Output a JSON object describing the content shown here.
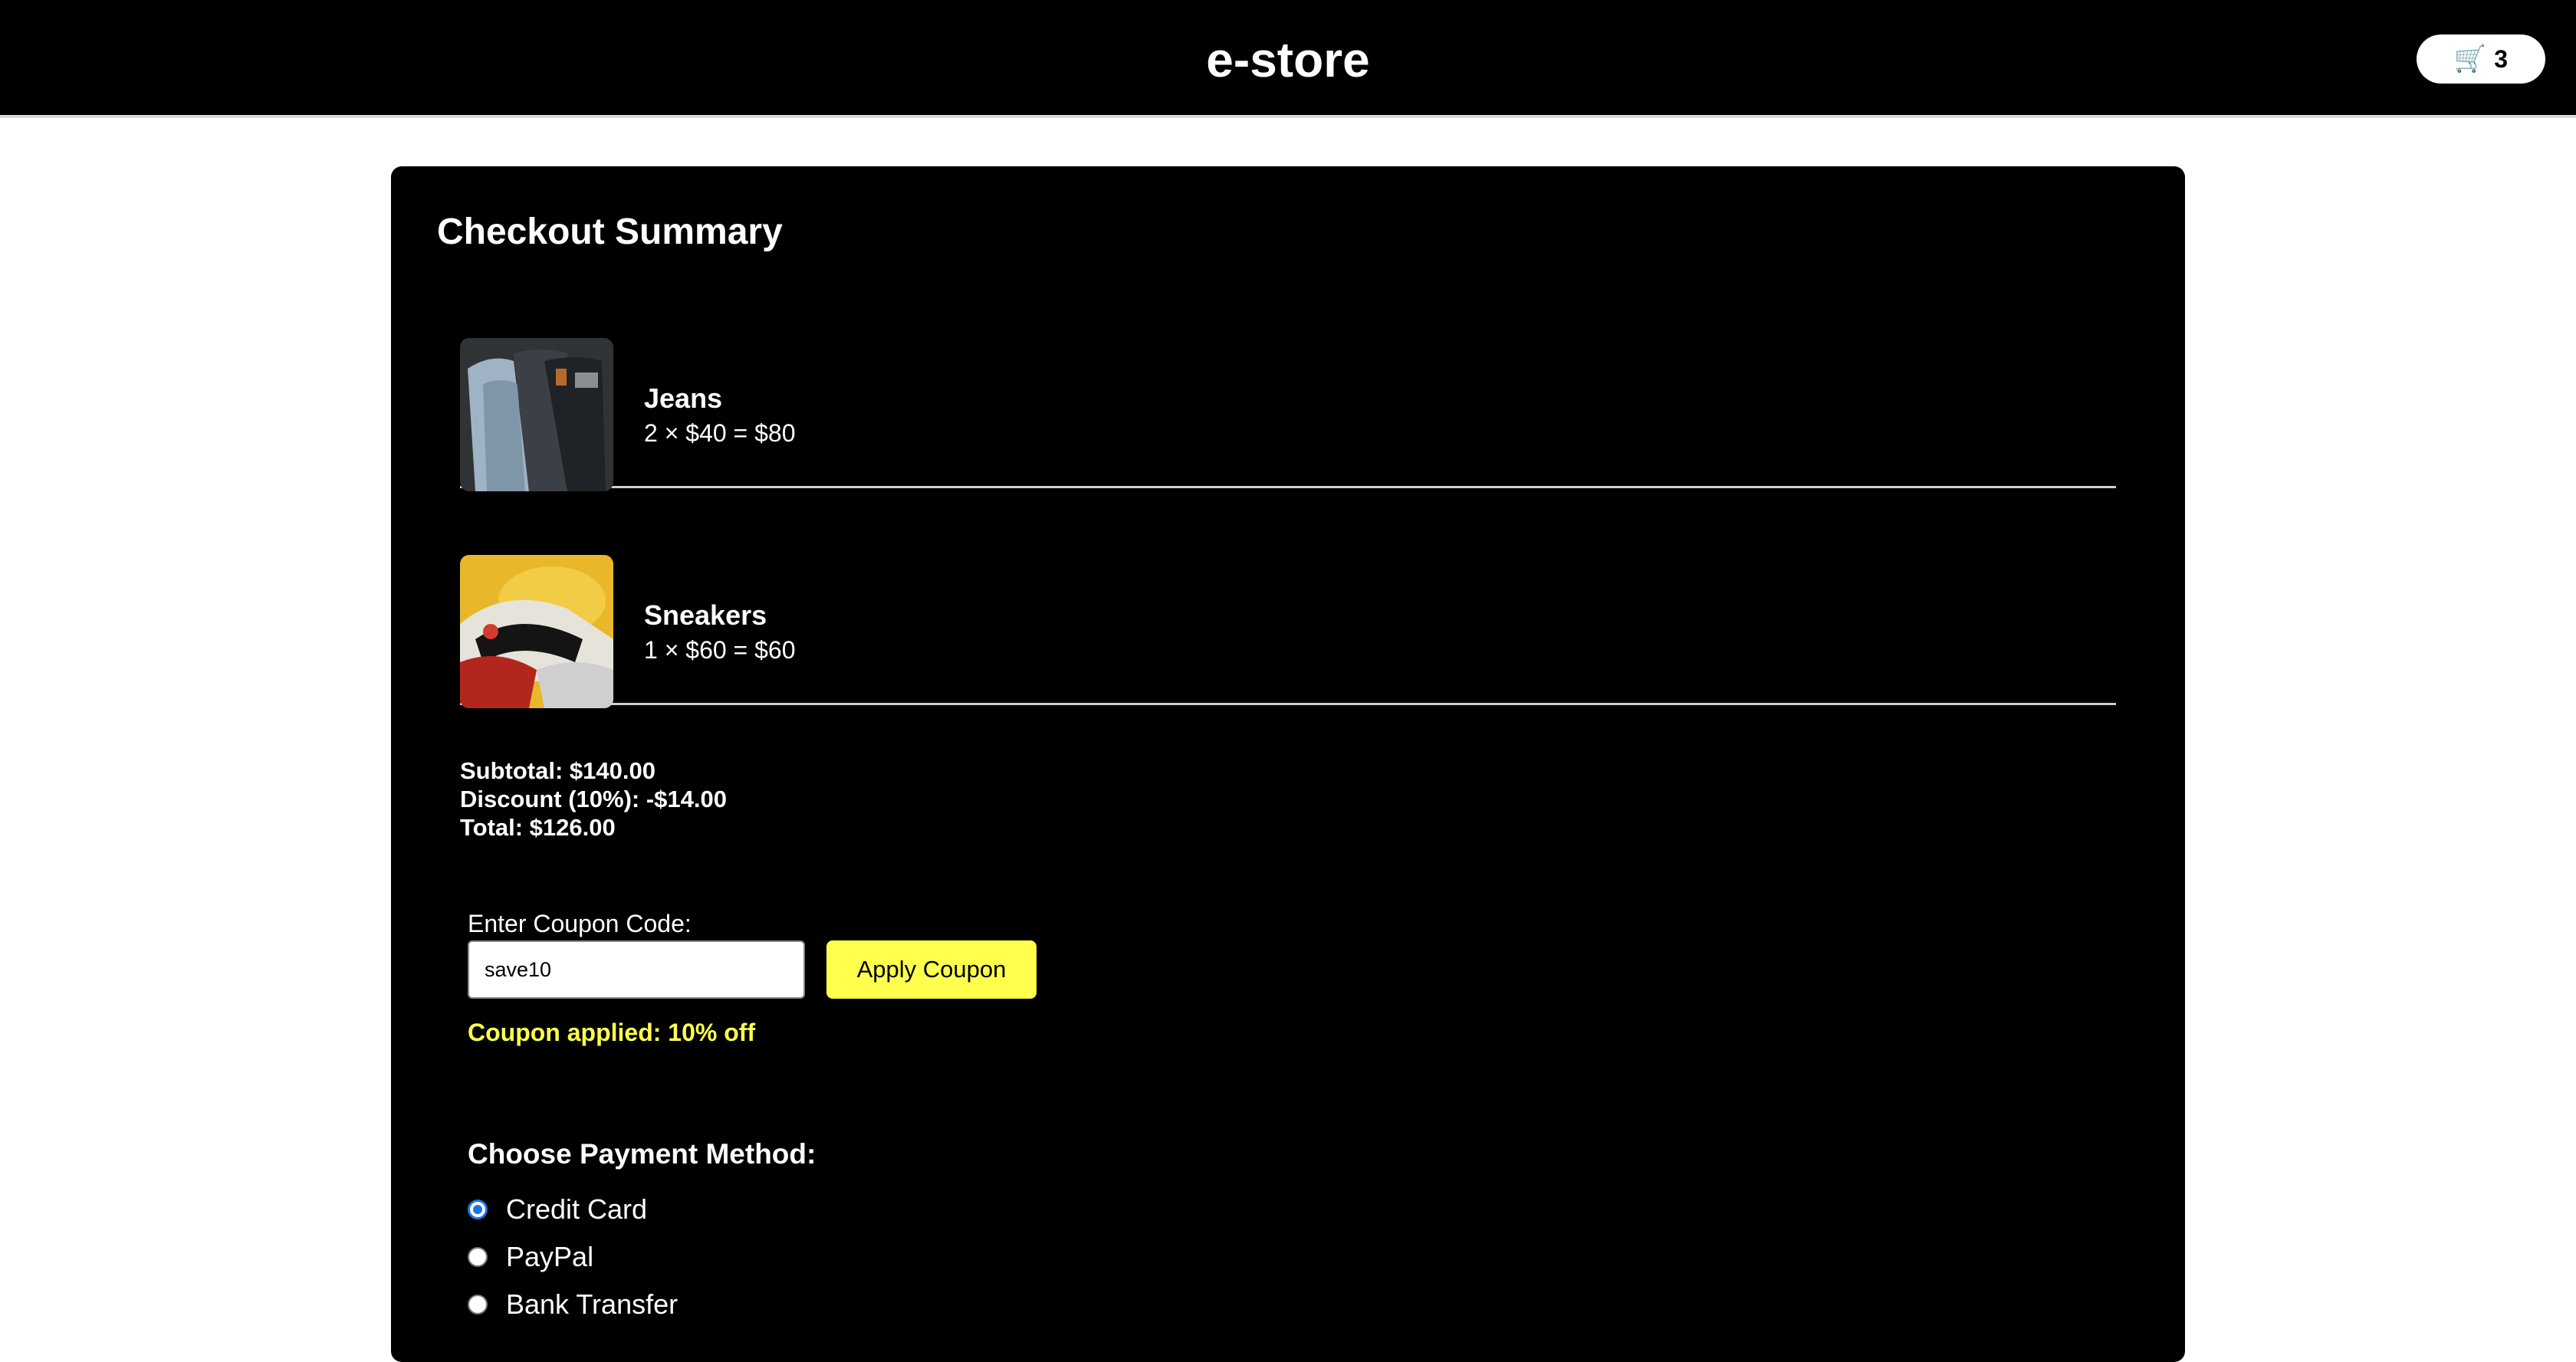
{
  "header": {
    "brand": "e-store",
    "cart_icon": "cart-icon",
    "cart_count": "3"
  },
  "checkout": {
    "title": "Checkout Summary",
    "items": [
      {
        "name": "Jeans",
        "line": "2 × $40 = $80",
        "image": "jeans-photo"
      },
      {
        "name": "Sneakers",
        "line": "1 × $60 = $60",
        "image": "sneakers-photo"
      }
    ],
    "subtotal": "Subtotal: $140.00",
    "discount": "Discount (10%): -$14.00",
    "total": "Total: $126.00"
  },
  "coupon": {
    "label": "Enter Coupon Code:",
    "value": "save10",
    "apply_label": "Apply Coupon",
    "status": "Coupon applied: 10% off"
  },
  "payment": {
    "heading": "Choose Payment Method:",
    "options": [
      "Credit Card",
      "PayPal",
      "Bank Transfer"
    ],
    "selected": "Credit Card"
  },
  "colors": {
    "accent_yellow": "#ffff4d",
    "radio_blue": "#1a73e8",
    "panel_bg": "#000000"
  }
}
